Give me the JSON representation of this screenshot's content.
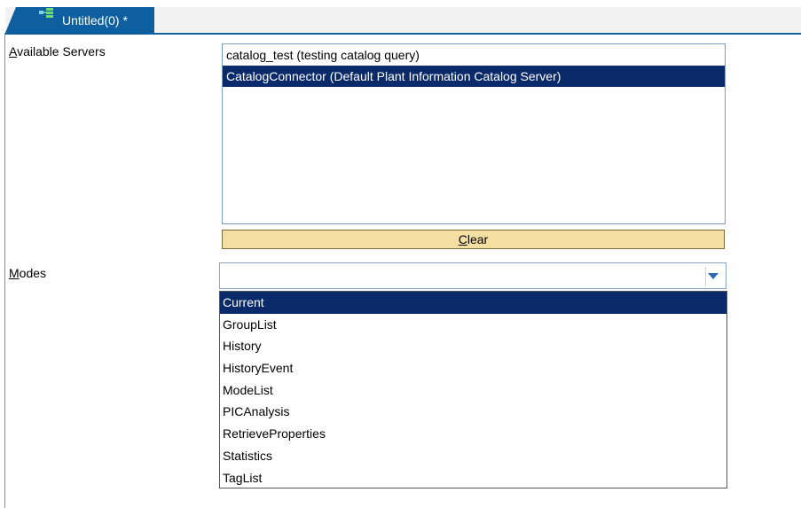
{
  "tab": {
    "label": "Untitled(0) *",
    "icon": "document-tree-icon"
  },
  "servers": {
    "label_mnemonic": "A",
    "label_rest": "vailable Servers",
    "items": [
      {
        "label": "catalog_test (testing catalog query)",
        "selected": false
      },
      {
        "label": "CatalogConnector (Default Plant Information Catalog Server)",
        "selected": true
      }
    ]
  },
  "clear_button": {
    "mnemonic": "C",
    "rest": "lear"
  },
  "modes": {
    "label_mnemonic": "M",
    "label_rest": "odes",
    "value": "",
    "options": [
      {
        "label": "Current",
        "selected": true
      },
      {
        "label": "GroupList",
        "selected": false
      },
      {
        "label": "History",
        "selected": false
      },
      {
        "label": "HistoryEvent",
        "selected": false
      },
      {
        "label": "ModeList",
        "selected": false
      },
      {
        "label": "PICAnalysis",
        "selected": false
      },
      {
        "label": "RetrieveProperties",
        "selected": false
      },
      {
        "label": "Statistics",
        "selected": false
      },
      {
        "label": "TagList",
        "selected": false
      }
    ]
  },
  "colors": {
    "tab_bg": "#0e5fa0",
    "selection_bg": "#0a2a6a",
    "clear_button_bg": "#f5dea1"
  }
}
